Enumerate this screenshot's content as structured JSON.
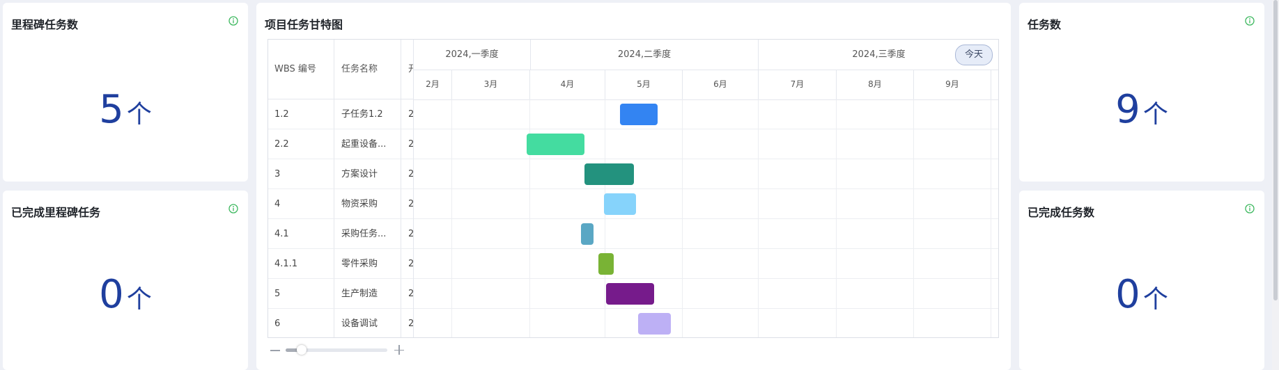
{
  "cards": {
    "milestone_tasks": {
      "title": "里程碑任务数",
      "value": "5",
      "unit": "个"
    },
    "completed_milestone_tasks": {
      "title": "已完成里程碑任务",
      "value": "0",
      "unit": "个"
    },
    "tasks": {
      "title": "任务数",
      "value": "9",
      "unit": "个"
    },
    "completed_tasks": {
      "title": "已完成任务数",
      "value": "0",
      "unit": "个"
    }
  },
  "gantt": {
    "title": "项目任务甘特图",
    "columns": {
      "wbs": "WBS 编号",
      "name": "任务名称",
      "start": "开"
    },
    "today_button": "今天",
    "quarters": [
      "2024,一季度",
      "2024,二季度",
      "2024,三季度"
    ],
    "months": [
      "2月",
      "3月",
      "4月",
      "5月",
      "6月",
      "7月",
      "8月",
      "9月"
    ],
    "rows": [
      {
        "wbs": "1.2",
        "name": "子任务1.2",
        "start": "2",
        "color": "#3384f2"
      },
      {
        "wbs": "2.2",
        "name": "起重设备...",
        "start": "2",
        "color": "#44dca0"
      },
      {
        "wbs": "3",
        "name": "方案设计",
        "start": "2",
        "color": "#23927e"
      },
      {
        "wbs": "4",
        "name": "物资采购",
        "start": "2",
        "color": "#86d3fb"
      },
      {
        "wbs": "4.1",
        "name": "采购任务...",
        "start": "2",
        "color": "#5aa7c4"
      },
      {
        "wbs": "4.1.1",
        "name": "零件采购",
        "start": "2",
        "color": "#79b335"
      },
      {
        "wbs": "5",
        "name": "生产制造",
        "start": "2",
        "color": "#761b8b"
      },
      {
        "wbs": "6",
        "name": "设备调试",
        "start": "2",
        "color": "#bdb0f5"
      }
    ]
  },
  "icons": {
    "info": "info-circle-icon",
    "zoom_out": "minus-icon",
    "zoom_in": "plus-icon"
  },
  "colors": {
    "accent_number": "#1f3f9e",
    "info_icon": "#3cb85e"
  }
}
